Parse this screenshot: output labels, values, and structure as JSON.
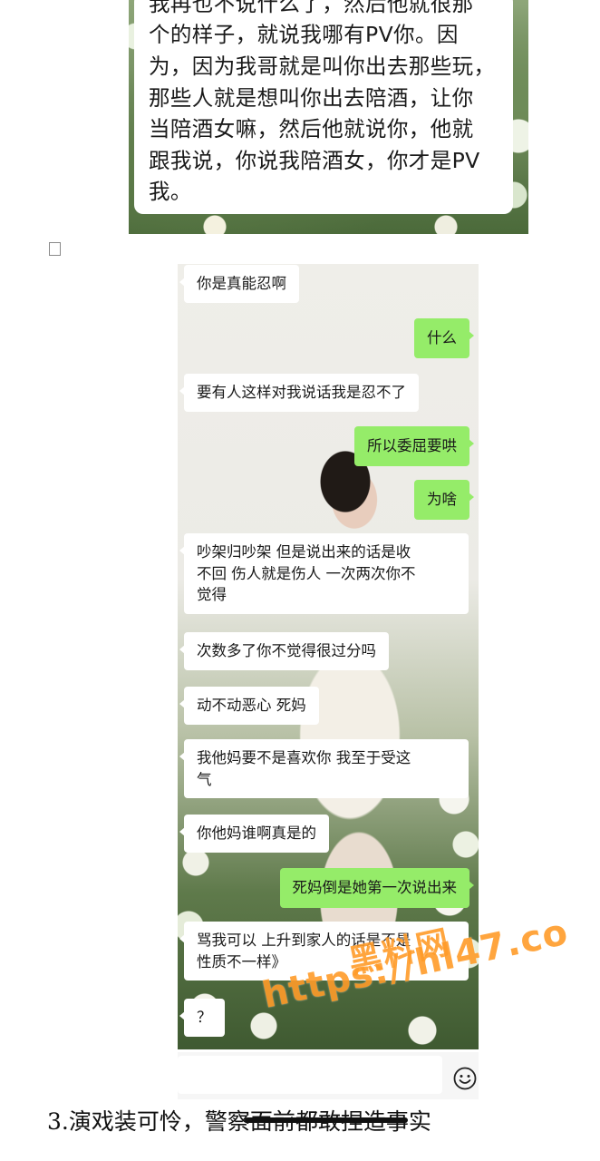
{
  "top_screenshot": {
    "lines": [
      "我再也不说什么了，然后他就很那",
      "个的样子，就说我哪有PV你。因",
      "为，因为我哥就是叫你出去那些玩，",
      "那些人就是想叫你出去陪酒，让你",
      "当陪酒女嘛，然后他就说你，他就",
      "跟我说，你说我陪酒女，你才是PV",
      "我。"
    ]
  },
  "chat": {
    "messages": [
      {
        "dir": "in",
        "lines": [
          "你是真能忍啊"
        ]
      },
      {
        "dir": "out",
        "lines": [
          "什么"
        ]
      },
      {
        "dir": "in",
        "lines": [
          "要有人这样对我说话我是忍不了"
        ]
      },
      {
        "dir": "out",
        "lines": [
          "所以委屈要哄"
        ]
      },
      {
        "dir": "out",
        "lines": [
          "为啥"
        ]
      },
      {
        "dir": "in",
        "lines": [
          "吵架归吵架 但是说出来的话是收",
          "不回 伤人就是伤人 一次两次你不",
          "觉得"
        ]
      },
      {
        "dir": "in",
        "lines": [
          "次数多了你不觉得很过分吗"
        ]
      },
      {
        "dir": "in",
        "lines": [
          "动不动恶心 死妈"
        ]
      },
      {
        "dir": "in",
        "lines": [
          "我他妈要不是喜欢你 我至于受这",
          "气"
        ]
      },
      {
        "dir": "in",
        "lines": [
          "你他妈谁啊真是的"
        ]
      },
      {
        "dir": "out",
        "lines": [
          "死妈倒是她第一次说出来"
        ]
      },
      {
        "dir": "in",
        "lines": [
          "骂我可以 上升到家人的话是不是",
          "性质不一样》"
        ]
      },
      {
        "dir": "in",
        "lines": [
          "？"
        ]
      }
    ],
    "emoji_icon": "smile-face-icon"
  },
  "caption": "3.演戏装可怜，警察面前都敢捏造事实",
  "watermark": {
    "title": "黑料网",
    "url": "https://hl47.co",
    "color": "#ff9c2a"
  },
  "colors": {
    "incoming_bubble": "#ffffff",
    "outgoing_bubble": "#95ec69"
  }
}
